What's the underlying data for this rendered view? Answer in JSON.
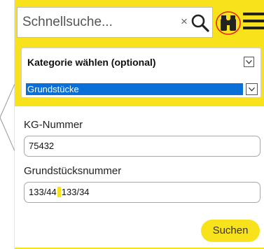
{
  "colors": {
    "accent": "#f7e21b",
    "selection": "#0a6fd6",
    "highlight_ring": "#e0261a"
  },
  "search": {
    "placeholder": "Schnellsuche...",
    "clear_symbol": "×",
    "search_icon": "magnifier-icon",
    "binoculars_icon": "binoculars-icon",
    "menu_icon": "hamburger-icon"
  },
  "category": {
    "label": "Kategorie wählen (optional)",
    "selected": "Grundstücke"
  },
  "form": {
    "kg_label": "KG-Nummer",
    "kg_value": "75432",
    "parcel_label": "Grundstücksnummer",
    "parcel_value_before": "133/44",
    "parcel_value_after": "133/34",
    "submit_label": "Suchen"
  }
}
